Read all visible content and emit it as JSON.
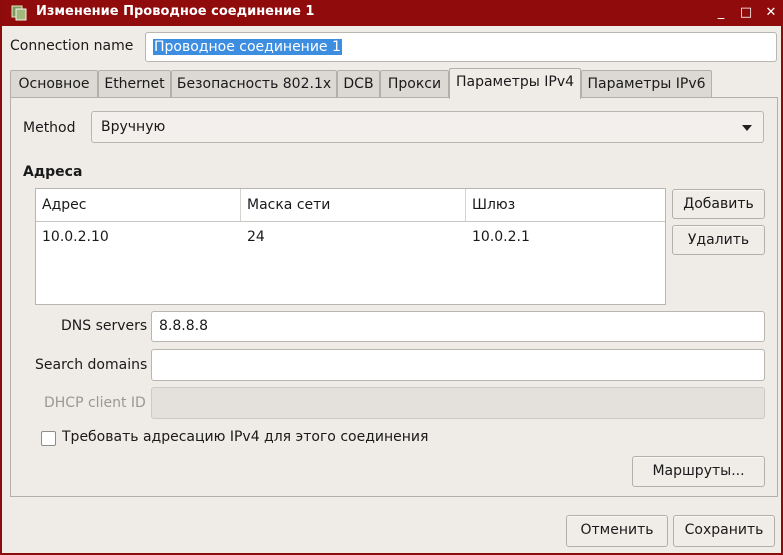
{
  "window": {
    "title": "Изменение Проводное соединение 1",
    "controls": {
      "minimize": "_",
      "maximize": "□",
      "close": "✕"
    },
    "accent": "#900b0b"
  },
  "connection_name": {
    "label": "Connection name",
    "value": "Проводное соединение 1"
  },
  "tabs": [
    {
      "label": "Основное"
    },
    {
      "label": "Ethernet"
    },
    {
      "label": "Безопасность 802.1x"
    },
    {
      "label": "DCB"
    },
    {
      "label": "Прокси"
    },
    {
      "label": "Параметры IPv4",
      "active": true
    },
    {
      "label": "Параметры IPv6"
    }
  ],
  "ipv4": {
    "method_label": "Method",
    "method_value": "Вручную",
    "addresses_title": "Адреса",
    "columns": [
      "Адрес",
      "Маска сети",
      "Шлюз"
    ],
    "rows": [
      [
        "10.0.2.10",
        "24",
        "10.0.2.1"
      ]
    ],
    "add_button": "Добавить",
    "delete_button": "Удалить",
    "dns_label": "DNS servers",
    "dns_value": "8.8.8.8",
    "search_label": "Search domains",
    "search_value": "",
    "dhcp_label": "DHCP client ID",
    "dhcp_value": "",
    "require_checkbox_label": "Требовать адресацию IPv4 для этого соединения",
    "require_checked": false,
    "routes_button": "Маршруты..."
  },
  "footer": {
    "cancel": "Отменить",
    "save": "Сохранить"
  },
  "icons": {
    "app": "network-connection-icon",
    "dropdown": "chevron-down-icon"
  }
}
